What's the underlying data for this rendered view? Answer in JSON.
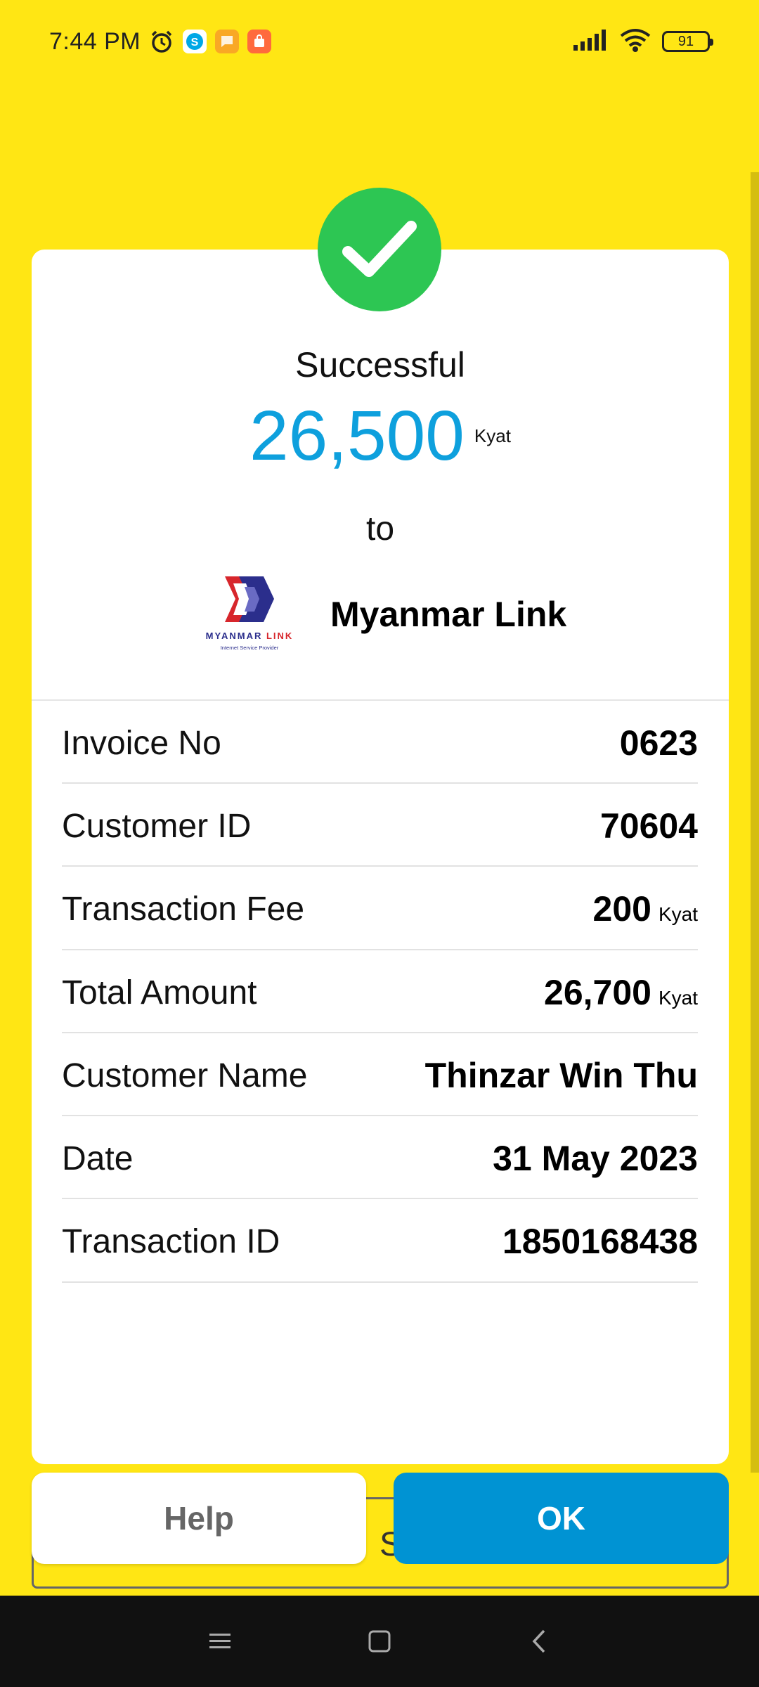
{
  "status_bar": {
    "time": "7:44 PM",
    "battery": "91",
    "icons": [
      "alarm-icon",
      "skype-icon",
      "messages-icon",
      "shop-icon",
      "signal-icon",
      "wifi-icon",
      "battery-icon"
    ]
  },
  "receipt": {
    "status": "Successful",
    "amount": "26,500",
    "currency": "Kyat",
    "to_label": "to",
    "merchant": {
      "name": "Myanmar Link",
      "logo_text": "MYANMAR LINK",
      "logo_subtext": "Internet Service Provider"
    },
    "details": [
      {
        "label": "Invoice No",
        "value": "0623",
        "unit": ""
      },
      {
        "label": "Customer ID",
        "value": "70604",
        "unit": ""
      },
      {
        "label": "Transaction Fee",
        "value": "200",
        "unit": "Kyat"
      },
      {
        "label": "Total Amount",
        "value": "26,700",
        "unit": "Kyat"
      },
      {
        "label": "Customer Name",
        "value": "Thinzar Win Thu",
        "unit": ""
      },
      {
        "label": "Date",
        "value": "31 May 2023",
        "unit": ""
      },
      {
        "label": "Transaction ID",
        "value": "1850168438",
        "unit": ""
      }
    ]
  },
  "buttons": {
    "help": "Help",
    "ok": "OK",
    "behind_text": "S"
  },
  "colors": {
    "background": "#FFE614",
    "success_green": "#2DC653",
    "amount_blue": "#0EA0DD",
    "ok_blue": "#0093D3"
  }
}
